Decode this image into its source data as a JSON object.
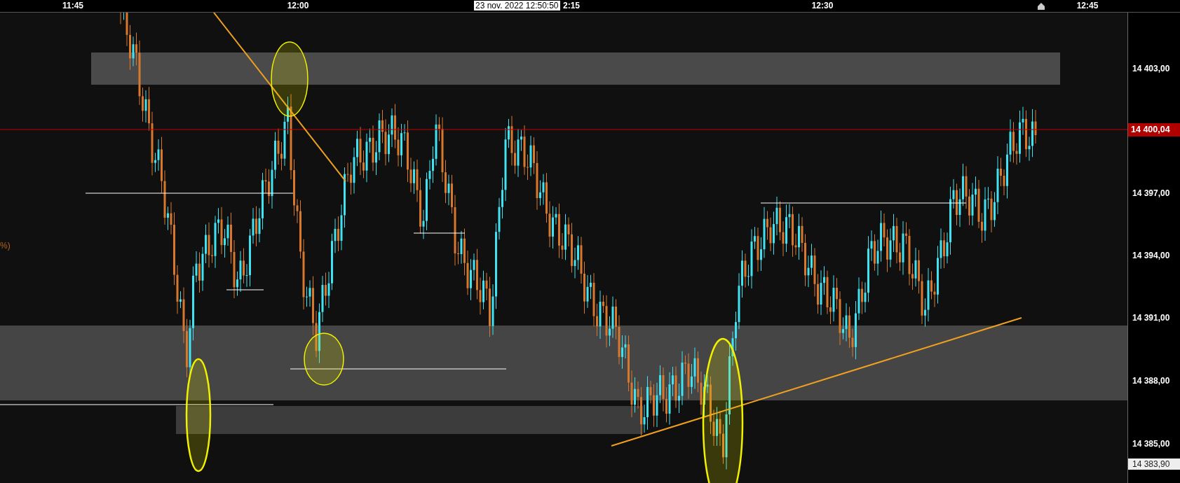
{
  "time_axis": {
    "labels": [
      "11:45",
      "12:00",
      "2:15",
      "12:30",
      "12:45"
    ],
    "crosshair_time": "23 nov. 2022 12:50:50"
  },
  "indicator_label": "%)",
  "price_axis": {
    "labels": [
      "14 403,00",
      "14 397,00",
      "14 394,00",
      "14 391,00",
      "14 388,00",
      "14 385,00"
    ],
    "current_price": "14 400,04",
    "low_price": "14 383,90"
  }
}
